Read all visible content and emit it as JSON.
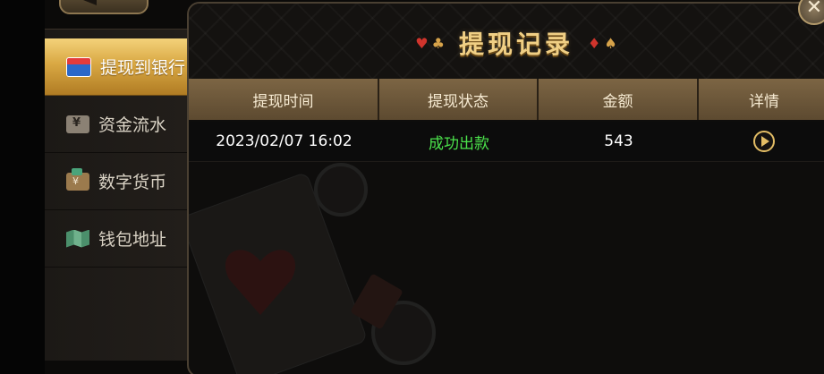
{
  "title": "提现记录",
  "title_suits_left": [
    "♥",
    "♣"
  ],
  "title_suits_right": [
    "♦",
    "♠"
  ],
  "close_icon": "✕",
  "sidebar": {
    "items": [
      {
        "label": "提现到银行",
        "icon": "bank-card-icon",
        "active": true
      },
      {
        "label": "资金流水",
        "icon": "ledger-icon",
        "active": false
      },
      {
        "label": "数字货币",
        "icon": "wallet-icon",
        "active": false
      },
      {
        "label": "钱包地址",
        "icon": "map-icon",
        "active": false
      }
    ]
  },
  "table": {
    "headers": [
      "提现时间",
      "提现状态",
      "金额",
      "详情"
    ],
    "rows": [
      {
        "time": "2023/02/07 16:02",
        "status": "成功出款",
        "amount": "543",
        "detail_icon": "chevron-right-circle-icon"
      }
    ]
  },
  "colors": {
    "accent_gold": "#e3bd65",
    "status_success": "#4be24b",
    "header_bg": "#6d5839",
    "active_tab": "#d9a843"
  }
}
